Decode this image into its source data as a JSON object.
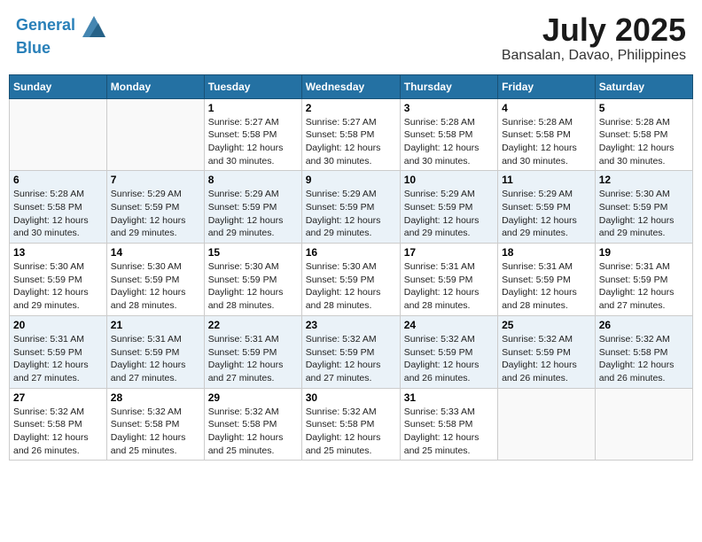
{
  "header": {
    "logo_line1": "General",
    "logo_line2": "Blue",
    "month": "July 2025",
    "location": "Bansalan, Davao, Philippines"
  },
  "days_of_week": [
    "Sunday",
    "Monday",
    "Tuesday",
    "Wednesday",
    "Thursday",
    "Friday",
    "Saturday"
  ],
  "weeks": [
    [
      {
        "day": "",
        "info": ""
      },
      {
        "day": "",
        "info": ""
      },
      {
        "day": "1",
        "info": "Sunrise: 5:27 AM\nSunset: 5:58 PM\nDaylight: 12 hours\nand 30 minutes."
      },
      {
        "day": "2",
        "info": "Sunrise: 5:27 AM\nSunset: 5:58 PM\nDaylight: 12 hours\nand 30 minutes."
      },
      {
        "day": "3",
        "info": "Sunrise: 5:28 AM\nSunset: 5:58 PM\nDaylight: 12 hours\nand 30 minutes."
      },
      {
        "day": "4",
        "info": "Sunrise: 5:28 AM\nSunset: 5:58 PM\nDaylight: 12 hours\nand 30 minutes."
      },
      {
        "day": "5",
        "info": "Sunrise: 5:28 AM\nSunset: 5:58 PM\nDaylight: 12 hours\nand 30 minutes."
      }
    ],
    [
      {
        "day": "6",
        "info": "Sunrise: 5:28 AM\nSunset: 5:58 PM\nDaylight: 12 hours\nand 30 minutes."
      },
      {
        "day": "7",
        "info": "Sunrise: 5:29 AM\nSunset: 5:59 PM\nDaylight: 12 hours\nand 29 minutes."
      },
      {
        "day": "8",
        "info": "Sunrise: 5:29 AM\nSunset: 5:59 PM\nDaylight: 12 hours\nand 29 minutes."
      },
      {
        "day": "9",
        "info": "Sunrise: 5:29 AM\nSunset: 5:59 PM\nDaylight: 12 hours\nand 29 minutes."
      },
      {
        "day": "10",
        "info": "Sunrise: 5:29 AM\nSunset: 5:59 PM\nDaylight: 12 hours\nand 29 minutes."
      },
      {
        "day": "11",
        "info": "Sunrise: 5:29 AM\nSunset: 5:59 PM\nDaylight: 12 hours\nand 29 minutes."
      },
      {
        "day": "12",
        "info": "Sunrise: 5:30 AM\nSunset: 5:59 PM\nDaylight: 12 hours\nand 29 minutes."
      }
    ],
    [
      {
        "day": "13",
        "info": "Sunrise: 5:30 AM\nSunset: 5:59 PM\nDaylight: 12 hours\nand 29 minutes."
      },
      {
        "day": "14",
        "info": "Sunrise: 5:30 AM\nSunset: 5:59 PM\nDaylight: 12 hours\nand 28 minutes."
      },
      {
        "day": "15",
        "info": "Sunrise: 5:30 AM\nSunset: 5:59 PM\nDaylight: 12 hours\nand 28 minutes."
      },
      {
        "day": "16",
        "info": "Sunrise: 5:30 AM\nSunset: 5:59 PM\nDaylight: 12 hours\nand 28 minutes."
      },
      {
        "day": "17",
        "info": "Sunrise: 5:31 AM\nSunset: 5:59 PM\nDaylight: 12 hours\nand 28 minutes."
      },
      {
        "day": "18",
        "info": "Sunrise: 5:31 AM\nSunset: 5:59 PM\nDaylight: 12 hours\nand 28 minutes."
      },
      {
        "day": "19",
        "info": "Sunrise: 5:31 AM\nSunset: 5:59 PM\nDaylight: 12 hours\nand 27 minutes."
      }
    ],
    [
      {
        "day": "20",
        "info": "Sunrise: 5:31 AM\nSunset: 5:59 PM\nDaylight: 12 hours\nand 27 minutes."
      },
      {
        "day": "21",
        "info": "Sunrise: 5:31 AM\nSunset: 5:59 PM\nDaylight: 12 hours\nand 27 minutes."
      },
      {
        "day": "22",
        "info": "Sunrise: 5:31 AM\nSunset: 5:59 PM\nDaylight: 12 hours\nand 27 minutes."
      },
      {
        "day": "23",
        "info": "Sunrise: 5:32 AM\nSunset: 5:59 PM\nDaylight: 12 hours\nand 27 minutes."
      },
      {
        "day": "24",
        "info": "Sunrise: 5:32 AM\nSunset: 5:59 PM\nDaylight: 12 hours\nand 26 minutes."
      },
      {
        "day": "25",
        "info": "Sunrise: 5:32 AM\nSunset: 5:59 PM\nDaylight: 12 hours\nand 26 minutes."
      },
      {
        "day": "26",
        "info": "Sunrise: 5:32 AM\nSunset: 5:58 PM\nDaylight: 12 hours\nand 26 minutes."
      }
    ],
    [
      {
        "day": "27",
        "info": "Sunrise: 5:32 AM\nSunset: 5:58 PM\nDaylight: 12 hours\nand 26 minutes."
      },
      {
        "day": "28",
        "info": "Sunrise: 5:32 AM\nSunset: 5:58 PM\nDaylight: 12 hours\nand 25 minutes."
      },
      {
        "day": "29",
        "info": "Sunrise: 5:32 AM\nSunset: 5:58 PM\nDaylight: 12 hours\nand 25 minutes."
      },
      {
        "day": "30",
        "info": "Sunrise: 5:32 AM\nSunset: 5:58 PM\nDaylight: 12 hours\nand 25 minutes."
      },
      {
        "day": "31",
        "info": "Sunrise: 5:33 AM\nSunset: 5:58 PM\nDaylight: 12 hours\nand 25 minutes."
      },
      {
        "day": "",
        "info": ""
      },
      {
        "day": "",
        "info": ""
      }
    ]
  ]
}
